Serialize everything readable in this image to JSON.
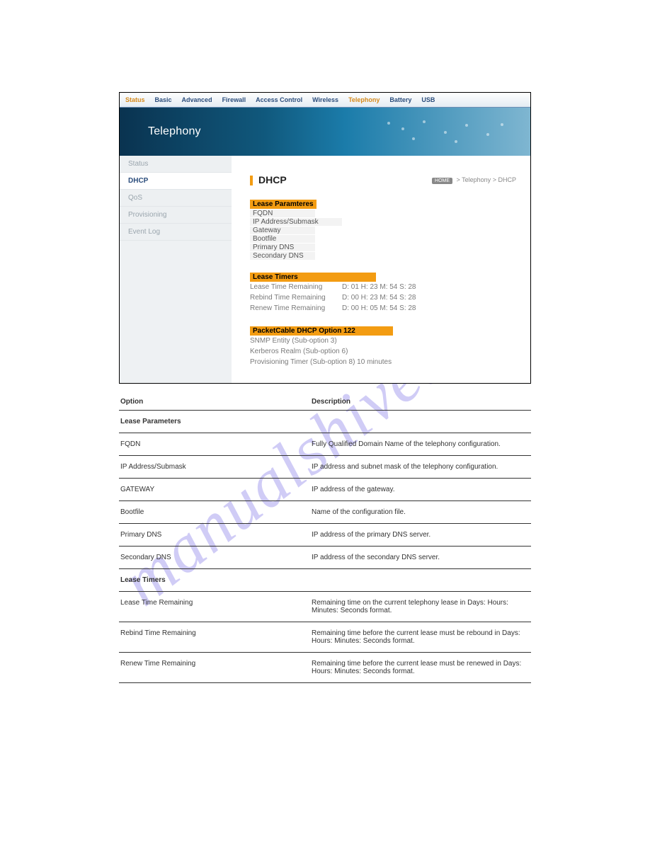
{
  "watermark": "manualshive.com",
  "topnav": {
    "items": [
      "Status",
      "Basic",
      "Advanced",
      "Firewall",
      "Access Control",
      "Wireless",
      "Telephony",
      "Battery",
      "USB"
    ],
    "active": [
      0,
      6
    ]
  },
  "hero": {
    "title": "Telephony"
  },
  "sidebar": {
    "items": [
      "Status",
      "DHCP",
      "QoS",
      "Provisioning",
      "Event Log"
    ],
    "selected": 1
  },
  "page_title": "DHCP",
  "breadcrumb": {
    "home": "HOME",
    "sep": ">",
    "a": "Telephony",
    "b": "DHCP"
  },
  "lease_params": {
    "header": "Lease Paramteres",
    "rows": [
      "FQDN",
      "IP Address/Submask",
      "Gateway",
      "Bootfile",
      "Primary DNS",
      "Secondary DNS"
    ]
  },
  "lease_timers": {
    "header": "Lease Timers",
    "rows": [
      {
        "label": "Lease Time Remaining",
        "value": "D: 01 H: 23 M: 54 S: 28"
      },
      {
        "label": "Rebind Time Remaining",
        "value": "D: 00 H: 23 M: 54 S: 28"
      },
      {
        "label": "Renew Time Remaining",
        "value": "D: 00 H: 05 M: 54 S: 28"
      }
    ]
  },
  "pc122": {
    "header": "PacketCable DHCP Option 122",
    "rows": [
      "SNMP Entity (Sub-option 3)",
      "Kerberos Realm (Sub-option 6)",
      "Provisioning Timer (Sub-option 8) 10 minutes"
    ]
  },
  "defs": {
    "head": [
      "Option",
      "Description"
    ],
    "section1": "Lease Parameters",
    "rows1": [
      {
        "k": "FQDN",
        "v": "Fully Qualified Domain Name of the telephony configuration."
      },
      {
        "k": "IP Address/Submask",
        "v": "IP address and subnet mask of the telephony configuration."
      },
      {
        "k": "GATEWAY",
        "v": "IP address of the gateway."
      },
      {
        "k": "Bootfile",
        "v": "Name of the configuration file."
      },
      {
        "k": "Primary DNS",
        "v": "IP address of the primary DNS server."
      },
      {
        "k": "Secondary DNS",
        "v": "IP address of the secondary DNS server."
      }
    ],
    "section2": "Lease Timers",
    "rows2": [
      {
        "k": "Lease Time Remaining",
        "v": "Remaining time on the current telephony lease in Days: Hours: Minutes: Seconds format."
      },
      {
        "k": "Rebind Time Remaining",
        "v": "Remaining time before the current lease must be rebound in Days: Hours: Minutes: Seconds format."
      },
      {
        "k": "Renew Time Remaining",
        "v": "Remaining time before the current lease must be renewed in Days: Hours: Minutes: Seconds format."
      }
    ]
  }
}
